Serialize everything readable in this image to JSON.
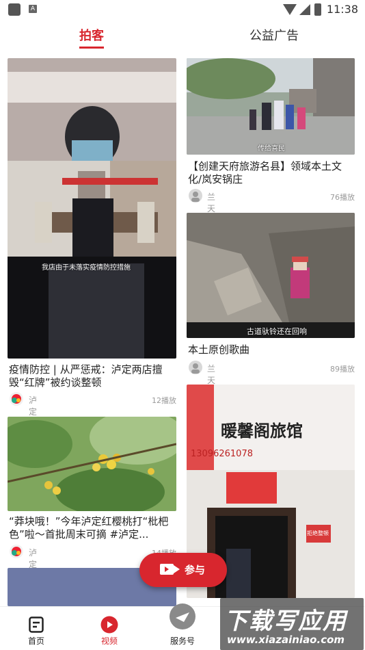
{
  "status_bar": {
    "time": "11:38"
  },
  "tabs": [
    {
      "label": "拍客",
      "active": true
    },
    {
      "label": "公益广告",
      "active": false
    }
  ],
  "feed": {
    "left": [
      {
        "title": "疫情防控 | 从严惩戒：泸定两店擅毁“红牌”被约谈整顿",
        "author": "泸定县融媒体中心",
        "views": "12播放",
        "caption": "我店由于未落实疫情防控措施"
      },
      {
        "title": "“莽块哦！”今年泸定红樱桃打“枇杷色”啦～首批周末可摘 #泸定...",
        "author": "泸定县融媒体中心",
        "views": "14播放"
      }
    ],
    "right": [
      {
        "title": "【创建天府旅游名县】领域本土文化/岚安锅庄",
        "author": "兰天",
        "views": "76播放",
        "caption": "传给喜民"
      },
      {
        "title": "本土原创歌曲",
        "author": "兰天",
        "views": "89播放",
        "caption": "古道驮铃还在回响"
      },
      {
        "sign_text": "暖馨阁旅馆",
        "sign_phone": "13096261078",
        "notice_text": "拒绝整顿"
      }
    ]
  },
  "fab": {
    "label": "参与"
  },
  "bottom_nav": [
    {
      "label": "首页",
      "icon": "home-doc-icon",
      "active": false
    },
    {
      "label": "视频",
      "icon": "video-play-icon",
      "active": true
    },
    {
      "label": "服务号",
      "icon": "service-logo-icon",
      "active": false
    }
  ],
  "watermark": {
    "big": "下载写应用",
    "small": "www.xiazainiao.com"
  },
  "colors": {
    "accent": "#d8262e",
    "text": "#222222",
    "muted": "#9a9a9a"
  }
}
